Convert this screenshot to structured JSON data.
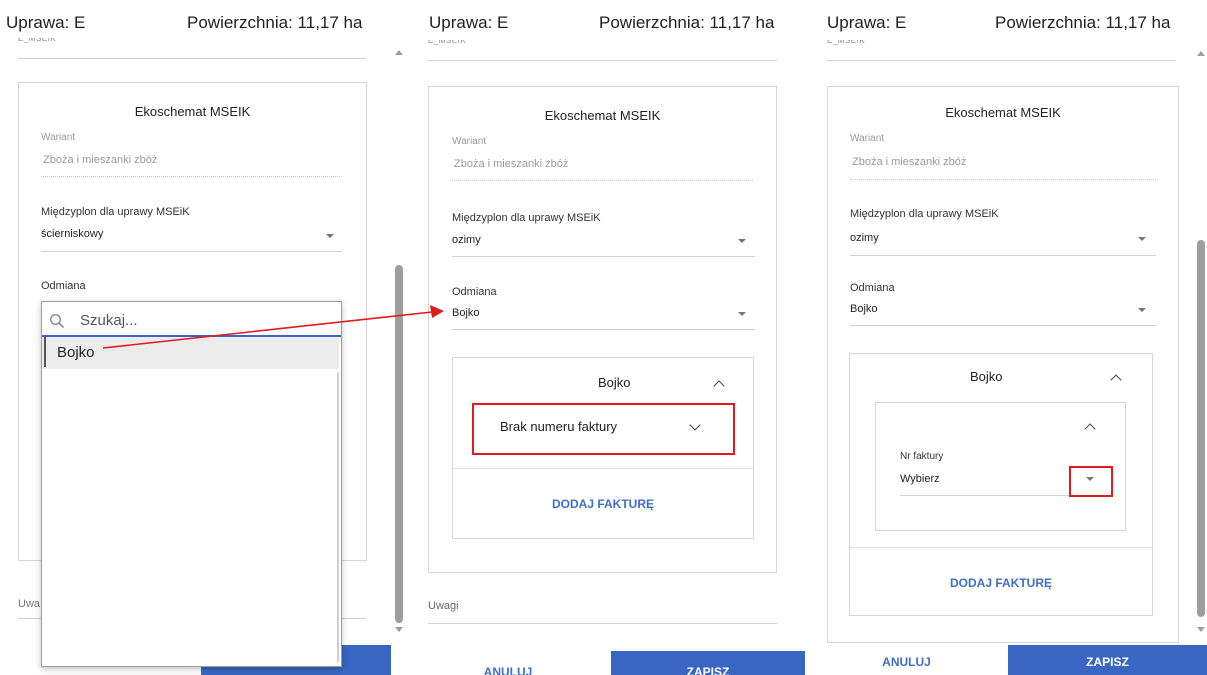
{
  "header": {
    "crop_label": "Uprawa: E",
    "area_label": "Powierzchnia: 11,17 ha"
  },
  "cut_text": "E_MSEIK",
  "ecoscheme": {
    "title": "Ekoschemat MSEIK",
    "variant_label": "Wariant",
    "variant_value": "Zboża i mieszanki zbóż",
    "catch_crop_label": "Międzyplon dla uprawy MSEiK",
    "odmiana_label": "Odmiana"
  },
  "panel1": {
    "catch_crop_value": "ścierniskowy",
    "search_placeholder": "Szukaj...",
    "options": [
      "Bojko"
    ],
    "remarks_label_partial": "Uwa"
  },
  "panel2": {
    "catch_crop_value": "ozimy",
    "odmiana_value": "Bojko",
    "variety_card_title": "Bojko",
    "no_invoice_label": "Brak numeru faktury",
    "add_invoice": "DODAJ FAKTURĘ",
    "remarks_label": "Uwagi",
    "cancel": "ANULUJ",
    "save": "ZAPISZ"
  },
  "panel3": {
    "catch_crop_value": "ozimy",
    "odmiana_value": "Bojko",
    "variety_card_title": "Bojko",
    "invoice_label": "Nr faktury",
    "invoice_value": "Wybierz",
    "add_invoice": "DODAJ FAKTURĘ",
    "cancel": "ANULUJ",
    "save": "ZAPISZ"
  },
  "colors": {
    "accent": "#3866c2",
    "link": "#3f6fc4",
    "highlight": "#e01b1b"
  },
  "icons": [
    "search-icon",
    "dropdown-arrow-icon",
    "chevron-up-icon",
    "chevron-down-icon",
    "scroll-up-icon",
    "scroll-down-icon"
  ]
}
